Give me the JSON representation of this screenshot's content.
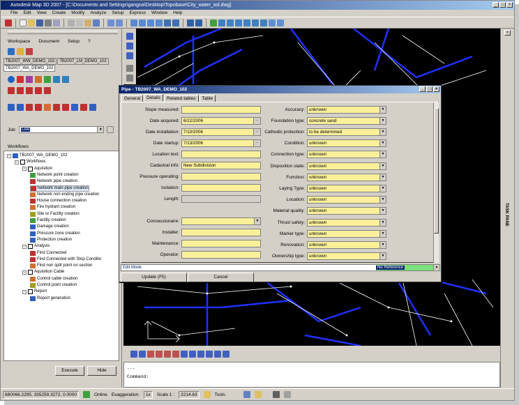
{
  "window": {
    "title": "Autodesk Map 3D 2007 - [C:\\Documents and Settings\\gangoa\\Desktop\\Topobase\\City_water_sol.dwg]"
  },
  "menu": [
    "File",
    "Edit",
    "View",
    "Create",
    "Modify",
    "Analyze",
    "Setup",
    "Express",
    "Window",
    "Help"
  ],
  "left": {
    "menu": [
      "Workspace",
      "Document",
      "Setup",
      "?"
    ],
    "tabs": [
      "TB2007_WW_DEMO_102",
      "TB2007_LM_DEMO_102",
      "TB2007_WA_DEMO_102"
    ],
    "job_label": "Job:",
    "job_value": "Live",
    "workflows_label": "Workflows",
    "tree": [
      {
        "label": "TB2007_WA_DEMO_102",
        "level": 0
      },
      {
        "label": "Workflows",
        "level": 1
      },
      {
        "label": "Aquisition",
        "level": 2
      },
      {
        "label": "Network point creation",
        "level": 3
      },
      {
        "label": "Network pipe creation",
        "level": 3
      },
      {
        "label": "Network main pipe creation",
        "level": 3,
        "selected": true
      },
      {
        "label": "Network non ending pipe creation",
        "level": 3
      },
      {
        "label": "House connection creation",
        "level": 3
      },
      {
        "label": "Fire hydrant creation",
        "level": 3
      },
      {
        "label": "Site or Facility creation",
        "level": 3
      },
      {
        "label": "Facility creation",
        "level": 3
      },
      {
        "label": "Damage creation",
        "level": 3
      },
      {
        "label": "Pressure zone creation",
        "level": 3
      },
      {
        "label": "Protection creation",
        "level": 3
      },
      {
        "label": "Analysis",
        "level": 2
      },
      {
        "label": "Find Connected",
        "level": 3
      },
      {
        "label": "Find Connected with Stop Conditio",
        "level": 3
      },
      {
        "label": "Find non split point on section",
        "level": 3
      },
      {
        "label": "Aquisition Cable",
        "level": 2
      },
      {
        "label": "Control cable creation",
        "level": 3
      },
      {
        "label": "Control point creation",
        "level": 3
      },
      {
        "label": "Report",
        "level": 2
      },
      {
        "label": "Report generation",
        "level": 3
      }
    ],
    "execute": "Execute",
    "hide": "Hide"
  },
  "dialog": {
    "title": "Pipe - TB2007_WA_DEMO_102",
    "tabs": [
      "General",
      "Details",
      "Related tables",
      "Table"
    ],
    "left_fields": [
      {
        "label": "Slope measured:",
        "value": ""
      },
      {
        "label": "Date acquired:",
        "value": "6/22/2006"
      },
      {
        "label": "Date installation:",
        "value": "7/10/2006"
      },
      {
        "label": "Date startup:",
        "value": "7/13/2006"
      },
      {
        "label": "Location text:",
        "value": ""
      },
      {
        "label": "Cadastral info:",
        "value": "New Subdivision"
      },
      {
        "label": "Pressure operating:",
        "value": ""
      },
      {
        "label": "Isolation:",
        "value": ""
      },
      {
        "label": "Length:",
        "value": ""
      },
      {
        "label": "Concessionaire:",
        "value": ""
      },
      {
        "label": "Installer:",
        "value": ""
      },
      {
        "label": "Maintenance:",
        "value": ""
      },
      {
        "label": "Operator:",
        "value": ""
      }
    ],
    "right_fields": [
      {
        "label": "Accuracy:",
        "value": "unknown"
      },
      {
        "label": "Foundation type:",
        "value": "concrete sand"
      },
      {
        "label": "Cathodic protection:",
        "value": "to be determined"
      },
      {
        "label": "Condition:",
        "value": "unknown"
      },
      {
        "label": "Connection type:",
        "value": "unknown"
      },
      {
        "label": "Disposition state:",
        "value": "unknown"
      },
      {
        "label": "Function:",
        "value": "unknown"
      },
      {
        "label": "Laying Type:",
        "value": "unknown"
      },
      {
        "label": "Location:",
        "value": "unknown"
      },
      {
        "label": "Material quality:",
        "value": "unknown"
      },
      {
        "label": "Thrust safety:",
        "value": "unknown"
      },
      {
        "label": "Marker type:",
        "value": "unknown"
      },
      {
        "label": "Renovation:",
        "value": "unknown"
      },
      {
        "label": "Ownership type:",
        "value": "unknown"
      }
    ],
    "edit_mode": "Edit Mode",
    "no_reference": "No Reference",
    "update_button": "Update (F5)",
    "cancel_button": "Cancel"
  },
  "task_pane": "TASK PANE",
  "command": {
    "line1": "...",
    "line2": "Command:"
  },
  "status": {
    "coords": "680066.2295, 335259.3272, 0.0000",
    "online": "Online",
    "exaggeration_label": "Exaggeration:",
    "exaggeration_value": "1x",
    "scale_label": "Scale 1 :",
    "scale_value": "2214.63",
    "tools": "Tools"
  }
}
